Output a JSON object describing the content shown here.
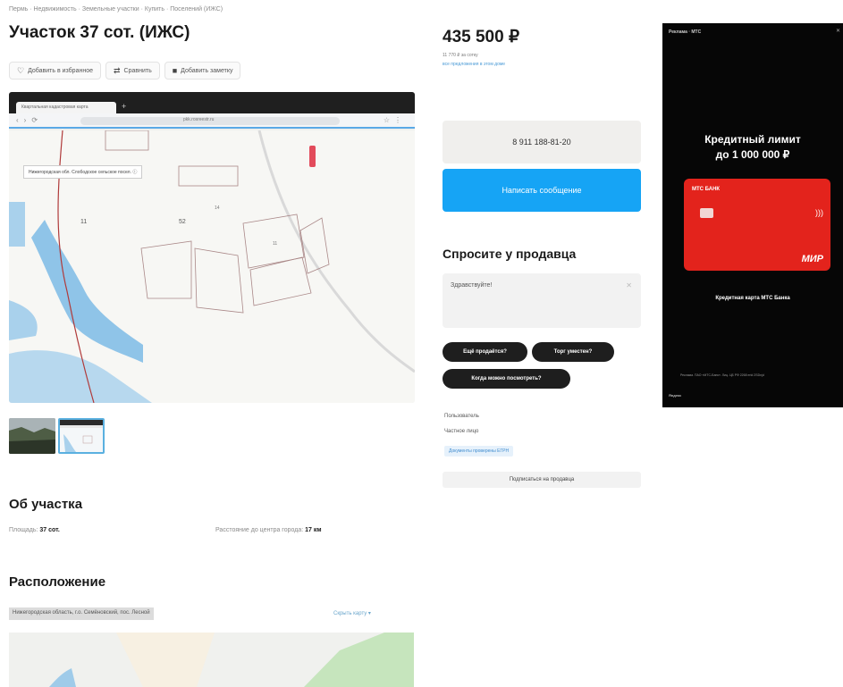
{
  "breadcrumb": "Пермь · Недвижимость · Земельные участки · Купить · Поселений (ИЖС)",
  "title": "Участок 37 сот. (ИЖС)",
  "actions": {
    "favorite": "Добавить в избранное",
    "compare": "Сравнить",
    "note": "Добавить заметку"
  },
  "gallery": {
    "tab_title": "Квартальная кадастровая карта",
    "url": "pkk.rosreestr.ru",
    "tooltip": "Нижегородская обл. Слободское сельское посел. ⓘ",
    "labels": [
      "52",
      "11",
      "14",
      "11"
    ]
  },
  "about": {
    "heading": "Об участка",
    "area_label": "Площадь:",
    "area_value": "37 сот.",
    "distance_label": "Расстояние до центра города:",
    "distance_value": "17 км"
  },
  "location": {
    "heading": "Расположение",
    "address": "Нижегородская область, г.о. Семёновский, пос. Лесной",
    "hide_map": "Скрыть карту ▾"
  },
  "price": {
    "value": "435 500 ₽",
    "per_unit": "11 770 ₽ за сотку",
    "link": "все предложения в этом доме"
  },
  "contact": {
    "phone": "8 911 188-81-20",
    "message_button": "Написать сообщение"
  },
  "ask": {
    "heading": "Спросите у продавца",
    "placeholder": "Здравствуйте!",
    "chips": [
      "Ещё продаётся?",
      "Торг уместен?",
      "Когда можно посмотреть?"
    ]
  },
  "seller": {
    "type_label": "Пользователь",
    "name": "Частное лицо",
    "badge": "Документы проверены ЕГРН",
    "subscribe": "Подписаться на продавца"
  },
  "ad": {
    "top_label": "Реклама · МТС",
    "close": "✕",
    "headline_1": "Кредитный лимит",
    "headline_2": "до 1 000 000 ₽",
    "card_logo": "МТС БАНК",
    "card_system": "МИР",
    "caption": "Кредитная карта МТС Банка",
    "legal": "Реклама. ПАО «МТС-Банк». Лиц. ЦБ РФ 2268 erid 2SDnjd",
    "brand": "Яндекс"
  },
  "colors": {
    "accent_blue": "#16a4f5",
    "card_red": "#e3231c",
    "water": "#8fc4e8"
  }
}
